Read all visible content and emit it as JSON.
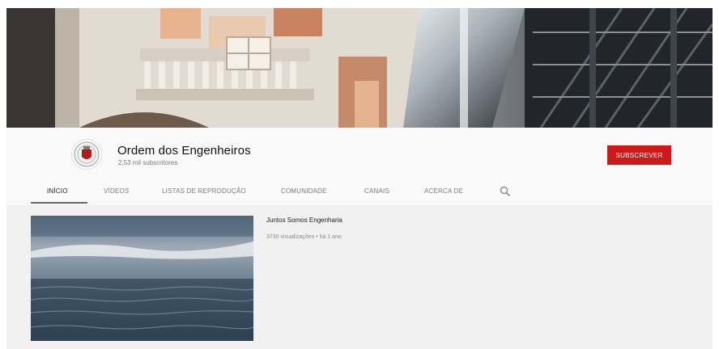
{
  "channel": {
    "name": "Ordem dos Engenheiros",
    "subscribers": "2,53 mil subscritores",
    "subscribe_label": "SUBSCREVER"
  },
  "tabs": [
    {
      "label": "INÍCIO",
      "active": true
    },
    {
      "label": "VÍDEOS",
      "active": false
    },
    {
      "label": "LISTAS DE REPRODUÇÃO",
      "active": false
    },
    {
      "label": "COMUNIDADE",
      "active": false
    },
    {
      "label": "CANAIS",
      "active": false
    },
    {
      "label": "ACERCA DE",
      "active": false
    }
  ],
  "search_icon": "search-icon",
  "featured_video": {
    "title": "Juntos Somos Engenharia",
    "meta": "3730 visualizações • há 1 ano"
  },
  "colors": {
    "subscribe": "#cc1a1a",
    "header_bg": "#f9f9f9",
    "content_bg": "#f1f1f1"
  }
}
